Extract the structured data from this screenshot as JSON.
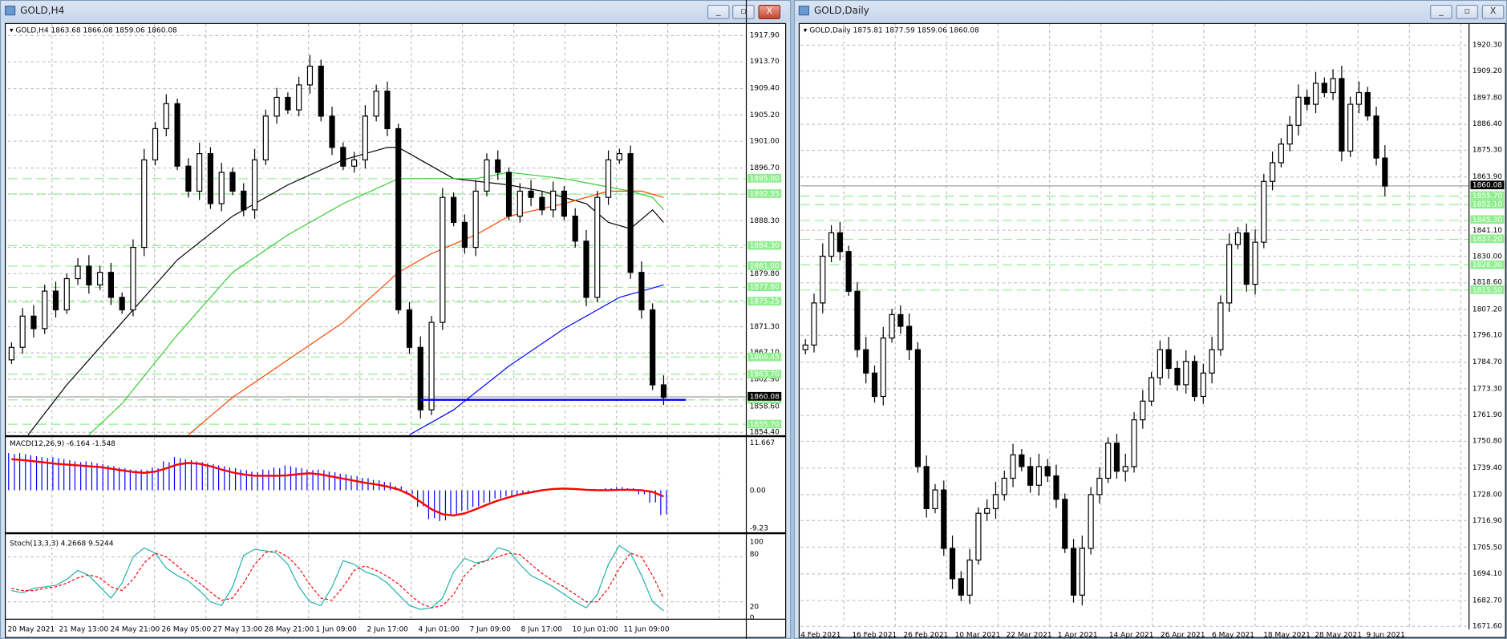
{
  "left": {
    "title": "GOLD,H4",
    "info": "GOLD,H4  1863.68 1866.08 1859.06 1860.08",
    "price_ticks": [
      "1917.90",
      "1913.70",
      "1909.40",
      "1905.20",
      "1901.00",
      "1896.70",
      "1892.50",
      "1888.30",
      "1884.00",
      "1879.80",
      "1875.50",
      "1871.30",
      "1867.10",
      "1862.90",
      "1858.60",
      "1854.40"
    ],
    "levels": [
      "1895.00",
      "1892.55",
      "1884.30",
      "1881.00",
      "1877.60",
      "1875.25",
      "1866.45",
      "1863.70",
      "1859.60",
      "1855.70"
    ],
    "current_price": "1860.08",
    "support_line": 1859.6,
    "dates": [
      "20 May 2021",
      "21 May 13:00",
      "24 May 21:00",
      "26 May 05:00",
      "27 May 13:00",
      "28 May 21:00",
      "1 Jun 09:00",
      "2 Jun 17:00",
      "4 Jun 01:00",
      "7 Jun 09:00",
      "8 Jun 17:00",
      "10 Jun 01:00",
      "11 Jun 09:00"
    ],
    "closes": [
      1868,
      1873,
      1871,
      1877,
      1874,
      1879,
      1881,
      1878,
      1880,
      1876,
      1874,
      1884,
      1898,
      1903,
      1907,
      1897,
      1893,
      1899,
      1891,
      1896,
      1893,
      1890,
      1898,
      1905,
      1908,
      1906,
      1910,
      1913,
      1905,
      1900,
      1897,
      1898,
      1905,
      1909,
      1903,
      1874,
      1868,
      1858,
      1872,
      1892,
      1888,
      1884,
      1893,
      1898,
      1896,
      1889,
      1893,
      1892,
      1890,
      1893,
      1889,
      1885,
      1876,
      1892,
      1898,
      1899,
      1880,
      1874,
      1862,
      1860
    ],
    "ma": [
      {
        "name": "ma-black",
        "color": "#000000",
        "points": [
          [
            1.5,
            1854
          ],
          [
            5,
            1862
          ],
          [
            10,
            1872
          ],
          [
            15,
            1882
          ],
          [
            20,
            1889
          ],
          [
            25,
            1894
          ],
          [
            30,
            1898
          ],
          [
            34,
            1900
          ],
          [
            35,
            1900
          ],
          [
            37,
            1898
          ],
          [
            40,
            1895
          ],
          [
            45,
            1894
          ],
          [
            48,
            1893
          ],
          [
            52,
            1891
          ],
          [
            54,
            1888
          ],
          [
            56,
            1887
          ],
          [
            58,
            1890
          ],
          [
            59,
            1888
          ]
        ]
      },
      {
        "name": "ma-green",
        "color": "#32cd32",
        "points": [
          [
            7,
            1854
          ],
          [
            10,
            1859
          ],
          [
            15,
            1870
          ],
          [
            20,
            1880
          ],
          [
            25,
            1886
          ],
          [
            30,
            1891
          ],
          [
            35,
            1895
          ],
          [
            38,
            1895
          ],
          [
            42,
            1895
          ],
          [
            45,
            1896
          ],
          [
            50,
            1895
          ],
          [
            53,
            1894
          ],
          [
            56,
            1893
          ],
          [
            58,
            1892
          ],
          [
            59,
            1890
          ]
        ]
      },
      {
        "name": "ma-orange",
        "color": "#ff4500",
        "points": [
          [
            16,
            1854
          ],
          [
            20,
            1860
          ],
          [
            25,
            1866
          ],
          [
            30,
            1872
          ],
          [
            35,
            1880
          ],
          [
            38,
            1883
          ],
          [
            42,
            1886
          ],
          [
            45,
            1889
          ],
          [
            50,
            1891
          ],
          [
            54,
            1893
          ],
          [
            57,
            1893
          ],
          [
            59,
            1892
          ]
        ]
      },
      {
        "name": "ma-blue",
        "color": "#0000ff",
        "points": [
          [
            36,
            1854
          ],
          [
            40,
            1858
          ],
          [
            45,
            1865
          ],
          [
            50,
            1871
          ],
          [
            55,
            1876
          ],
          [
            59,
            1878
          ]
        ]
      }
    ],
    "macd": {
      "label": "MACD(12,26,9) -6.164 -1.548",
      "ticks": [
        "11.667",
        "0.00",
        "-9.23"
      ],
      "range": [
        -9.23,
        11.667
      ],
      "hist": [
        9,
        9,
        8.5,
        8,
        8,
        7.5,
        7,
        7,
        6.5,
        6,
        5.5,
        5,
        5,
        5.5,
        7,
        8,
        7.5,
        7,
        6.5,
        6,
        5.5,
        5,
        4.5,
        5,
        5.5,
        6,
        5.5,
        5,
        5,
        4.5,
        4,
        3.5,
        3,
        2.5,
        2,
        1,
        -1,
        -4,
        -7,
        -7.5,
        -6,
        -5,
        -4,
        -3,
        -2,
        -1.5,
        -1,
        -0.5,
        0,
        0,
        0,
        0,
        0,
        0.3,
        0.5,
        0.8,
        0.5,
        -1,
        -3,
        -6
      ],
      "signal": [
        7.5,
        7.3,
        7,
        6.7,
        6.4,
        6.2,
        6,
        5.8,
        5.6,
        5.2,
        4.8,
        4.4,
        4.2,
        4.5,
        5.3,
        6.2,
        6.6,
        6.4,
        5.8,
        5,
        4.3,
        3.8,
        3.5,
        3.5,
        3.5,
        3.6,
        3.9,
        4.1,
        3.8,
        3.3,
        2.8,
        2.3,
        1.8,
        1.4,
        0.9,
        0.2,
        -1,
        -2.8,
        -4.6,
        -5.8,
        -6.1,
        -5.6,
        -4.6,
        -3.5,
        -2.5,
        -1.7,
        -1,
        -0.5,
        0,
        0.3,
        0.4,
        0.3,
        0.1,
        0,
        0,
        0.1,
        0.1,
        0,
        -0.4,
        -1.5
      ]
    },
    "stoch": {
      "label": "Stoch(13,3,3) 4.2668 9.5244",
      "ticks": [
        "100",
        "80",
        "20",
        "0"
      ],
      "main": [
        35,
        32,
        38,
        40,
        42,
        50,
        62,
        55,
        40,
        25,
        45,
        80,
        92,
        85,
        65,
        55,
        48,
        35,
        20,
        15,
        40,
        82,
        90,
        88,
        85,
        70,
        40,
        20,
        15,
        40,
        75,
        70,
        60,
        55,
        45,
        30,
        15,
        10,
        12,
        25,
        60,
        78,
        72,
        75,
        92,
        88,
        70,
        55,
        48,
        40,
        30,
        20,
        12,
        30,
        70,
        95,
        85,
        55,
        20,
        8
      ],
      "signal": [
        38,
        35,
        35,
        38,
        40,
        45,
        52,
        56,
        52,
        40,
        35,
        50,
        72,
        85,
        80,
        68,
        55,
        45,
        33,
        22,
        25,
        45,
        70,
        86,
        88,
        80,
        65,
        43,
        25,
        22,
        40,
        62,
        68,
        62,
        54,
        44,
        30,
        18,
        12,
        15,
        30,
        55,
        70,
        75,
        80,
        85,
        83,
        70,
        58,
        48,
        40,
        30,
        20,
        20,
        38,
        65,
        85,
        80,
        55,
        25
      ]
    }
  },
  "right": {
    "title": "GOLD,Daily",
    "info": "GOLD,Daily  1875.81 1877.59 1859.06 1860.08",
    "price_ticks": [
      "1920.30",
      "1909.20",
      "1897.80",
      "1886.40",
      "1875.30",
      "1863.90",
      "1841.10",
      "1830.00",
      "1818.60",
      "1807.20",
      "1796.10",
      "1784.70",
      "1773.30",
      "1761.90",
      "1750.80",
      "1739.40",
      "1728.00",
      "1716.90",
      "1705.50",
      "1694.10",
      "1682.70",
      "1671.60"
    ],
    "levels": [
      "1855.70",
      "1852.10",
      "1845.30",
      "1837.20",
      "1826.30",
      "1815.50"
    ],
    "current_price": "1860.08",
    "dates": [
      "4 Feb 2021",
      "16 Feb 2021",
      "26 Feb 2021",
      "10 Mar 2021",
      "22 Mar 2021",
      "1 Apr 2021",
      "14 Apr 2021",
      "26 Apr 2021",
      "6 May 2021",
      "18 May 2021",
      "28 May 2021",
      "9 Jun 2021"
    ],
    "closes": [
      1792,
      1810,
      1830,
      1840,
      1832,
      1815,
      1790,
      1780,
      1770,
      1795,
      1805,
      1800,
      1790,
      1740,
      1722,
      1730,
      1705,
      1692,
      1685,
      1700,
      1720,
      1722,
      1728,
      1735,
      1745,
      1740,
      1732,
      1740,
      1736,
      1726,
      1705,
      1685,
      1705,
      1728,
      1735,
      1750,
      1738,
      1740,
      1760,
      1768,
      1778,
      1790,
      1782,
      1775,
      1785,
      1770,
      1780,
      1790,
      1810,
      1835,
      1840,
      1818,
      1836,
      1862,
      1870,
      1878,
      1886,
      1898,
      1895,
      1904,
      1900,
      1906,
      1875,
      1895,
      1900,
      1890,
      1872,
      1860
    ]
  },
  "buttons": {
    "minimize": "_",
    "restore": "▫",
    "close": "X"
  },
  "colors": {
    "level": "#90ee90",
    "bull": "#ffffff",
    "bear": "#000000",
    "macd_hist": "#0000ff",
    "macd_signal": "#ff0000",
    "stoch_main": "#20b2aa",
    "stoch_signal": "#ff0000",
    "support": "#0000ff"
  }
}
